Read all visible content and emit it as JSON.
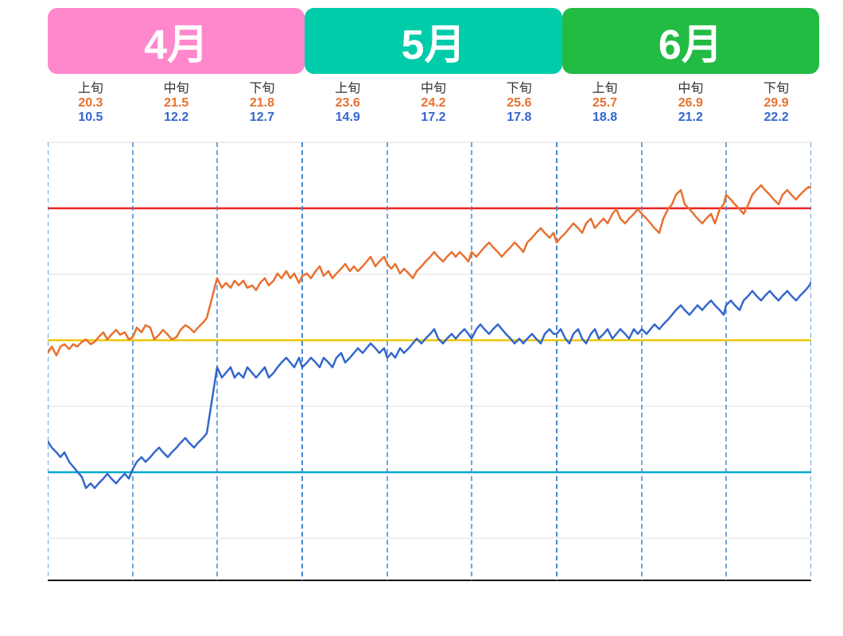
{
  "months": [
    {
      "label": "4月",
      "class": "april",
      "periods": [
        {
          "name": "上旬",
          "high": "20.3",
          "low": "10.5"
        },
        {
          "name": "中旬",
          "high": "21.5",
          "low": "12.2"
        },
        {
          "name": "下旬",
          "high": "21.8",
          "low": "12.7"
        }
      ]
    },
    {
      "label": "5月",
      "class": "may",
      "periods": [
        {
          "name": "上旬",
          "high": "23.6",
          "low": "14.9"
        },
        {
          "name": "中旬",
          "high": "24.2",
          "low": "17.2"
        },
        {
          "name": "下旬",
          "high": "25.6",
          "low": "17.8"
        }
      ]
    },
    {
      "label": "6月",
      "class": "june",
      "periods": [
        {
          "name": "上旬",
          "high": "25.7",
          "low": "18.8"
        },
        {
          "name": "中旬",
          "high": "26.9",
          "low": "21.2"
        },
        {
          "name": "下旬",
          "high": "29.9",
          "low": "22.2"
        }
      ]
    }
  ],
  "y_axis": [
    "0",
    "5",
    "10",
    "15",
    "20",
    "25",
    "30",
    "35"
  ],
  "reference_lines": {
    "red": 30,
    "yellow": 20,
    "cyan": 10,
    "black": 0
  }
}
